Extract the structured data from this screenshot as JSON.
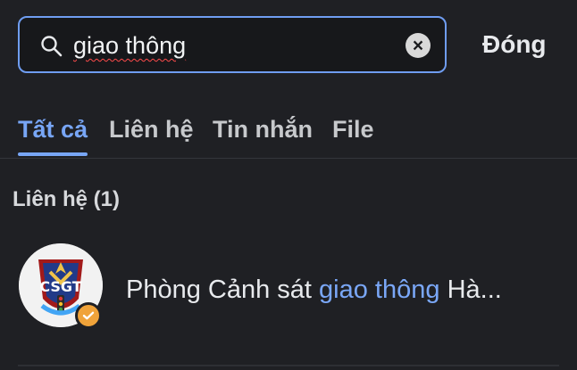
{
  "search": {
    "value": "giao thông",
    "clear_icon": "close-circle-icon",
    "search_icon": "search-icon"
  },
  "header": {
    "close_label": "Đóng"
  },
  "tabs": [
    {
      "label": "Tất cả",
      "active": true
    },
    {
      "label": "Liên hệ",
      "active": false
    },
    {
      "label": "Tin nhắn",
      "active": false
    },
    {
      "label": "File",
      "active": false
    }
  ],
  "results": {
    "contacts_title": "Liên hệ (1)",
    "contacts": [
      {
        "name_prefix": "Phòng Cảnh sát ",
        "name_match": "giao thông",
        "name_suffix": " Hà...",
        "avatar_label": "CSGT",
        "verified_icon": "verified-check-icon"
      }
    ]
  },
  "colors": {
    "accent": "#78a6f6",
    "background": "#1f2024",
    "search_border": "#6f9df1",
    "badge": "#f0a33a"
  }
}
